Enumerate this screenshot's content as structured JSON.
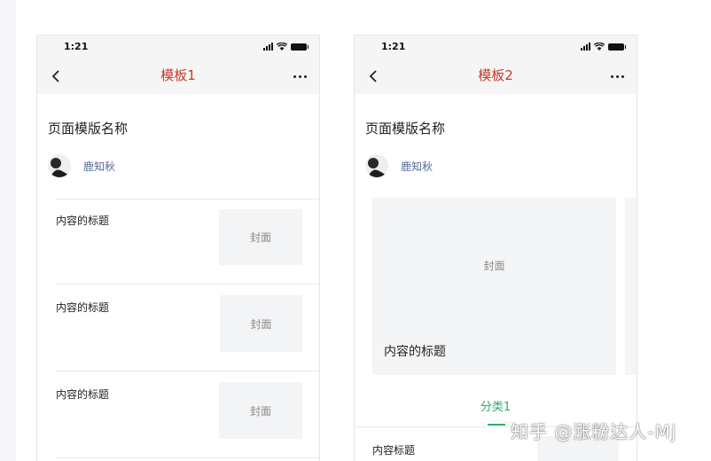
{
  "phones": [
    {
      "status": {
        "time": "1:21"
      },
      "nav": {
        "title": "模板1"
      },
      "page_name": "页面模版名称",
      "author": "鹿知秋",
      "items": [
        {
          "title": "内容的标题",
          "cover": "封面"
        },
        {
          "title": "内容的标题",
          "cover": "封面"
        },
        {
          "title": "内容的标题",
          "cover": "封面"
        }
      ]
    },
    {
      "status": {
        "time": "1:21"
      },
      "nav": {
        "title": "模板2"
      },
      "page_name": "页面模版名称",
      "author": "鹿知秋",
      "card": {
        "cover": "封面",
        "title": "内容的标题"
      },
      "category": {
        "label": "分类1"
      },
      "list_item": {
        "title": "内容标题"
      }
    }
  ],
  "watermark": "知乎 @涨粉达人-Mj",
  "colors": {
    "accent_red": "#c83a2a",
    "green": "#2aae67",
    "author_blue": "#576b95"
  },
  "icons": [
    "back-icon",
    "more-icon",
    "signal-icon",
    "wifi-icon",
    "battery-icon"
  ]
}
